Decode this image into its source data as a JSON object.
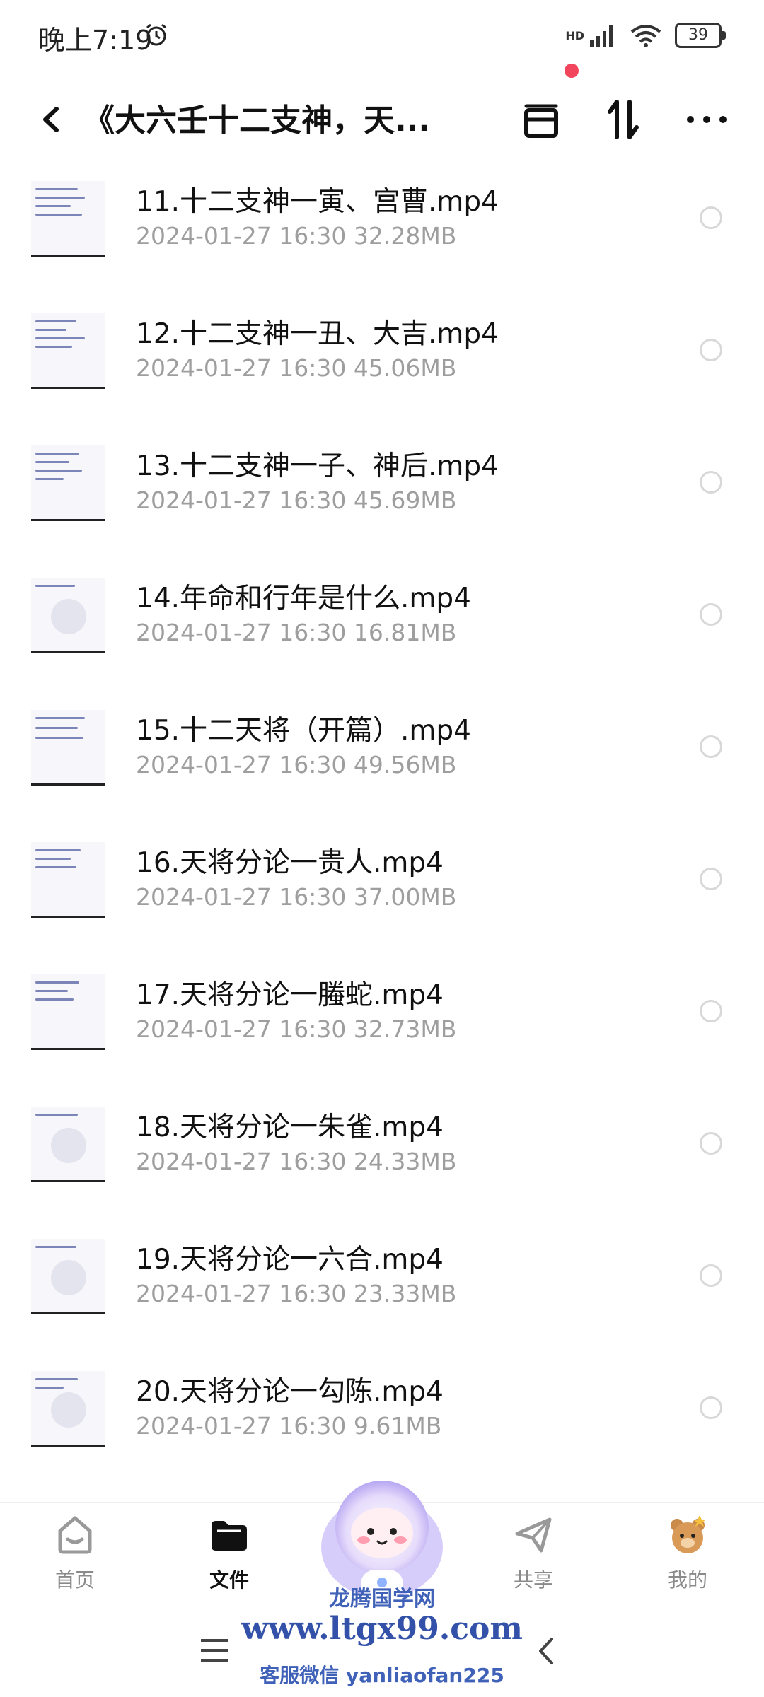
{
  "status": {
    "time": "晚上7:19",
    "network": "HD",
    "battery": "39"
  },
  "header": {
    "title": "《大六壬十二支神，天..."
  },
  "files": [
    {
      "name": "11.十二支神一寅、宫曹.mp4",
      "meta": "2024-01-27   16:30   32.28MB"
    },
    {
      "name": "12.十二支神一丑、大吉.mp4",
      "meta": "2024-01-27   16:30   45.06MB"
    },
    {
      "name": "13.十二支神一子、神后.mp4",
      "meta": "2024-01-27   16:30   45.69MB"
    },
    {
      "name": "14.年命和行年是什么.mp4",
      "meta": "2024-01-27   16:30   16.81MB"
    },
    {
      "name": "15.十二天将（开篇）.mp4",
      "meta": "2024-01-27   16:30   49.56MB"
    },
    {
      "name": "16.天将分论一贵人.mp4",
      "meta": "2024-01-27   16:30   37.00MB"
    },
    {
      "name": "17.天将分论一螣蛇.mp4",
      "meta": "2024-01-27   16:30   32.73MB"
    },
    {
      "name": "18.天将分论一朱雀.mp4",
      "meta": "2024-01-27   16:30   24.33MB"
    },
    {
      "name": "19.天将分论一六合.mp4",
      "meta": "2024-01-27   16:30   23.33MB"
    },
    {
      "name": "20.天将分论一勾陈.mp4",
      "meta": "2024-01-27   16:30   9.61MB"
    }
  ],
  "nav": {
    "home": "首页",
    "files": "文件",
    "share": "共享",
    "mine": "我的"
  },
  "watermark": {
    "line1": "龙腾国学网",
    "line2": "www.ltgx99.com",
    "line3": "客服微信 yanliaofan225"
  },
  "colors": {
    "accent_dot": "#f2445b",
    "meta_text": "#9e9e9e",
    "watermark": "#3351a8"
  }
}
